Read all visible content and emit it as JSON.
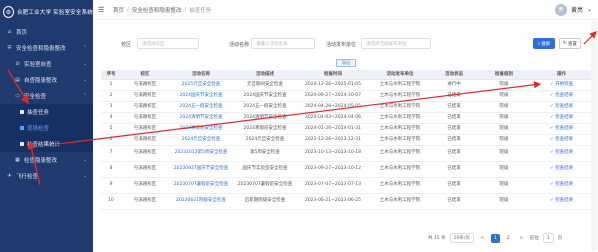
{
  "app": {
    "logo_glyph": "⚙",
    "logo_text": "合肥工业大学 实验室安全系统"
  },
  "sidebar": {
    "items": [
      {
        "label": "首页",
        "icon": "home-icon",
        "glyph": "⌂"
      },
      {
        "label": "安全检查和隐患整改",
        "icon": "shield-icon",
        "glyph": "⛨",
        "caret": "⌃"
      },
      {
        "label": "实验室自查",
        "icon": "check-icon",
        "glyph": "⊙",
        "caret": "⌄"
      },
      {
        "label": "自查隐患整改",
        "icon": "tool-icon",
        "glyph": "▤",
        "caret": "⌄"
      },
      {
        "label": "安全检查",
        "icon": "chat-icon",
        "glyph": "▭",
        "caret": "⌃"
      },
      {
        "label": "抽查任务",
        "icon": "square-icon"
      },
      {
        "label": "现场检查",
        "icon": "square-icon"
      },
      {
        "label": "抽查结果统计",
        "icon": "square-icon"
      },
      {
        "label": "检查隐患整改",
        "icon": "list-icon",
        "glyph": "▦",
        "caret": "⌄"
      },
      {
        "label": "飞行检查",
        "icon": "plane-icon",
        "glyph": "✈",
        "caret": "⌄"
      }
    ]
  },
  "topbar": {
    "menu_glyph": "☰",
    "breadcrumb": [
      "首页",
      "安全检查和隐患整改",
      "抽查任务"
    ],
    "separator": "/",
    "user_name": "黄亮",
    "user_glyph": "⌄",
    "avatar_text": "黄"
  },
  "filters": {
    "campus_label": "校区",
    "campus_placeholder": "请选择校区",
    "name_label": "活动名称",
    "name_placeholder": "请输入活动名称",
    "dept_label": "活动发布单位",
    "dept_placeholder": "请选择活动发布单位",
    "search_label": "搜索",
    "search_glyph": "⌕",
    "reset_label": "重置",
    "reset_glyph": "↻",
    "export_label": "导出"
  },
  "table": {
    "headers": [
      "序号",
      "校区",
      "活动名称",
      "活动描述",
      "检查时间",
      "活动发布单位",
      "活动状态",
      "检查级别",
      "操作"
    ],
    "rows": [
      {
        "no": "1",
        "campus": "屯溪路校区",
        "name": "2025元旦安全检查",
        "desc": "元旦期间安全检查",
        "time": "2024-12-26~2025-01-05",
        "dept": "土木与水利工程学院",
        "status": "进行中",
        "level": "院级",
        "op": "✓ 开始检查"
      },
      {
        "no": "2",
        "campus": "屯溪路校区",
        "name": "2024国庆节安全检查",
        "desc": "2024国庆节安全检查",
        "time": "2024-09-27~2024-10-07",
        "dept": "土木与水利工程学院",
        "status": "已结束",
        "level": "院级",
        "op": "✓ 检查结果"
      },
      {
        "no": "3",
        "campus": "屯溪路校区",
        "name": "2024五一假安全检查",
        "desc": "2024五一假安全检查",
        "time": "2024-04-28~2024-05-05",
        "dept": "土木与水利工程学院",
        "status": "已结束",
        "level": "院级",
        "op": "✓ 检查结果"
      },
      {
        "no": "4",
        "campus": "屯溪路校区",
        "name": "2024清明节安全检查",
        "desc": "2024清明节安全检查",
        "time": "2024-04-03~2024-04-06",
        "dept": "土木与水利工程学院",
        "status": "已结束",
        "level": "院级",
        "op": "✓ 检查结果"
      },
      {
        "no": "5",
        "campus": "屯溪路校区",
        "name": "2024寒假前安全检查",
        "desc": "2024寒假前安全检查",
        "time": "2024-01-26~2024-01-31",
        "dept": "土木与水利工程学院",
        "status": "已结束",
        "level": "院级",
        "op": "✓ 检查结果"
      },
      {
        "no": "6",
        "campus": "屯溪路校区",
        "name": "2024元旦安全检查",
        "desc": "2024元旦安全检查",
        "time": "2023-12-26~2023-12-31",
        "dept": "土木与水利工程学院",
        "status": "已结束",
        "level": "院级",
        "op": "✓ 检查结果"
      },
      {
        "no": "7",
        "campus": "屯溪路校区",
        "name": "20231013第5周安全检查",
        "desc": "第5周安全检查",
        "time": "2023-10-13~2023-10-18",
        "dept": "土木与水利工程学院",
        "status": "已结束",
        "level": "院级",
        "op": "✓ 检查结果"
      },
      {
        "no": "8",
        "campus": "屯溪路校区",
        "name": "20230927国庆节安全检查",
        "desc": "国庆节实验室安全检查",
        "time": "2023-09-27~2023-10-12",
        "dept": "土木与水利工程学院",
        "status": "已结束",
        "level": "院级",
        "op": "✓ 检查结果"
      },
      {
        "no": "9",
        "campus": "屯溪路校区",
        "name": "20230707暑假前安全检查",
        "desc": "20230707暑假前安全检查",
        "time": "2023-07-07~2023-07-13",
        "dept": "土木与水利工程学院",
        "status": "已结束",
        "level": "院级",
        "op": "✓ 检查结果"
      },
      {
        "no": "10",
        "campus": "屯溪路校区",
        "name": "20230621院级安全检查",
        "desc": "启新期院级安全检查",
        "time": "2023-06-21~2023-06-25",
        "dept": "土木与水利工程学院",
        "status": "已结束",
        "level": "院级",
        "op": "✓ 检查结果"
      }
    ]
  },
  "pager": {
    "total": "共 15 条",
    "page_size": "10条/页",
    "prev": "<",
    "pages": [
      "1",
      "2"
    ],
    "next": ">",
    "goto_prefix": "前往",
    "goto_value": "1",
    "goto_suffix": "页"
  },
  "colors": {
    "sidebar": "#1f3a6e",
    "accent": "#2d6fd6",
    "annotation": "#e02a2a"
  }
}
